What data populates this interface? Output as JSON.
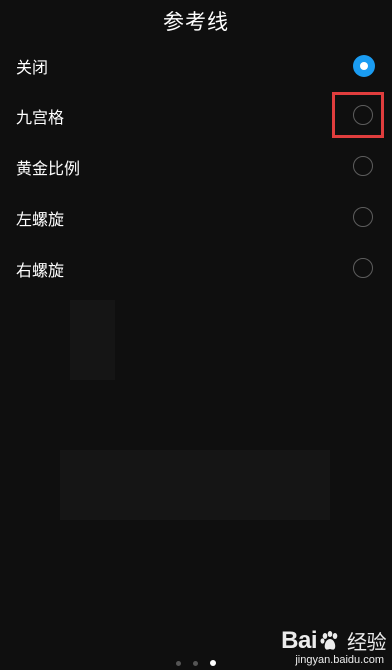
{
  "header": {
    "title": "参考线"
  },
  "options": [
    {
      "label": "关闭",
      "selected": true
    },
    {
      "label": "九宫格",
      "selected": false
    },
    {
      "label": "黄金比例",
      "selected": false
    },
    {
      "label": "左螺旋",
      "selected": false
    },
    {
      "label": "右螺旋",
      "selected": false
    }
  ],
  "pager": {
    "count": 3,
    "active_index": 2
  },
  "watermark": {
    "brand_prefix": "Bai",
    "brand_suffix": "经验",
    "url": "jingyan.baidu.com"
  },
  "colors": {
    "background": "#0f0f0f",
    "accent": "#1a9cf2",
    "highlight": "#e03d3d"
  }
}
